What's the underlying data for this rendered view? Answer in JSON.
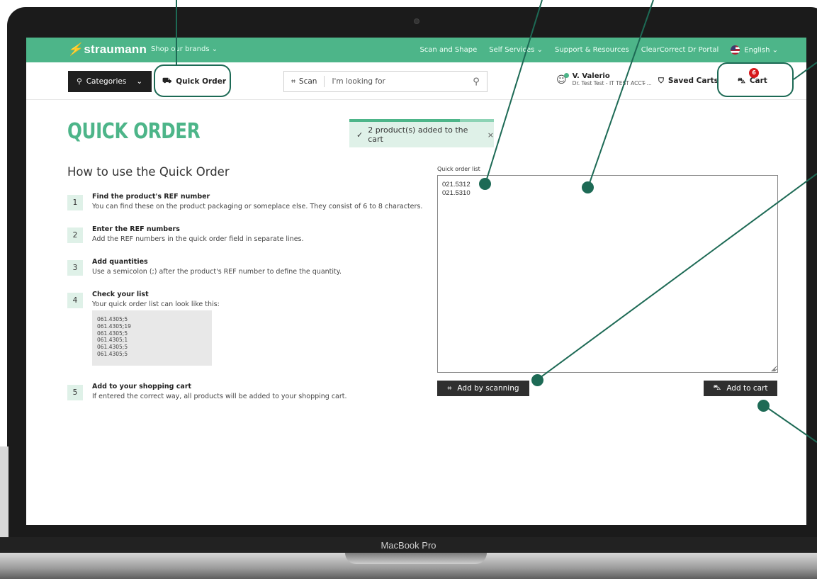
{
  "device": {
    "label": "MacBook Pro"
  },
  "topbar": {
    "logo": "straumann",
    "brands": "Shop our brands",
    "nav": [
      "Scan and Shape",
      "Self Services",
      "Support & Resources",
      "ClearCorrect Dr Portal"
    ],
    "language": "English"
  },
  "navbar": {
    "categories": "Categories",
    "quick_order": "Quick Order",
    "scan": "Scan",
    "search_placeholder": "I'm looking for",
    "user_name": "V. Valerio",
    "user_account": "Dr. Test Test - IT TEST ACCT ...",
    "saved_carts": "Saved Carts",
    "cart": "Cart",
    "cart_count": "6"
  },
  "page": {
    "title": "QUICK ORDER",
    "toast": "2 product(s) added to the cart",
    "howto_title": "How to use the Quick Order",
    "steps": [
      {
        "num": "1",
        "title": "Find the product's REF number",
        "text": "You can find these on the product packaging or someplace else. They consist of 6 to 8 characters."
      },
      {
        "num": "2",
        "title": "Enter the REF numbers",
        "text": "Add the REF numbers in the quick order field in separate lines."
      },
      {
        "num": "3",
        "title": "Add quantities",
        "text": "Use a semicolon (;) after the product's REF number to define the quantity."
      },
      {
        "num": "4",
        "title": "Check your list",
        "text": "Your quick order list can look like this:"
      },
      {
        "num": "5",
        "title": "Add to your shopping cart",
        "text": "If entered the correct way, all products will be added to your shopping cart."
      }
    ],
    "example": [
      "061.4305;5",
      "061.4305;19",
      "061.4305;5",
      "061.4305;1",
      "061.4305;5",
      "061.4305;5"
    ],
    "quick_order_label": "Quick order list",
    "quick_order_value": "021.5312\n021.5310",
    "add_by_scanning": "Add by scanning",
    "add_to_cart": "Add to cart"
  },
  "colors": {
    "brand_green": "#4db589",
    "callout": "#1d6a55",
    "badge_red": "#d7191c",
    "dark_button": "#2f2f2f"
  }
}
